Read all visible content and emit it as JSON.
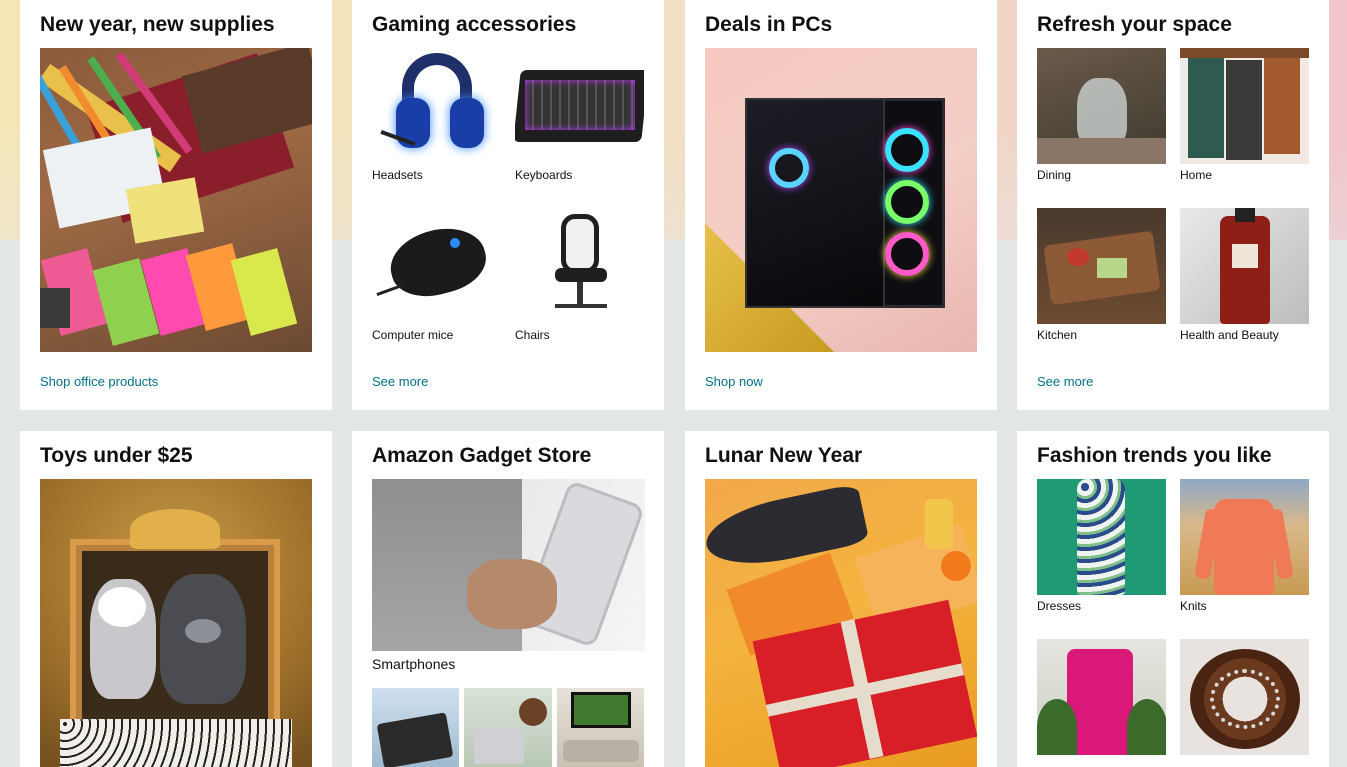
{
  "cards": [
    {
      "title": "New year, new supplies",
      "link": "Shop office products"
    },
    {
      "title": "Gaming accessories",
      "link": "See more",
      "items": [
        "Headsets",
        "Keyboards",
        "Computer mice",
        "Chairs"
      ]
    },
    {
      "title": "Deals in PCs",
      "link": "Shop now"
    },
    {
      "title": "Refresh your space",
      "link": "See more",
      "items": [
        "Dining",
        "Home",
        "Kitchen",
        "Health and Beauty"
      ]
    },
    {
      "title": "Toys under $25"
    },
    {
      "title": "Amazon Gadget Store",
      "items": [
        "Smartphones"
      ]
    },
    {
      "title": "Lunar New Year"
    },
    {
      "title": "Fashion trends you like",
      "items": [
        "Dresses",
        "Knits"
      ]
    }
  ],
  "colors": {
    "link": "#007185",
    "page_bg": "#e3e6e6"
  }
}
